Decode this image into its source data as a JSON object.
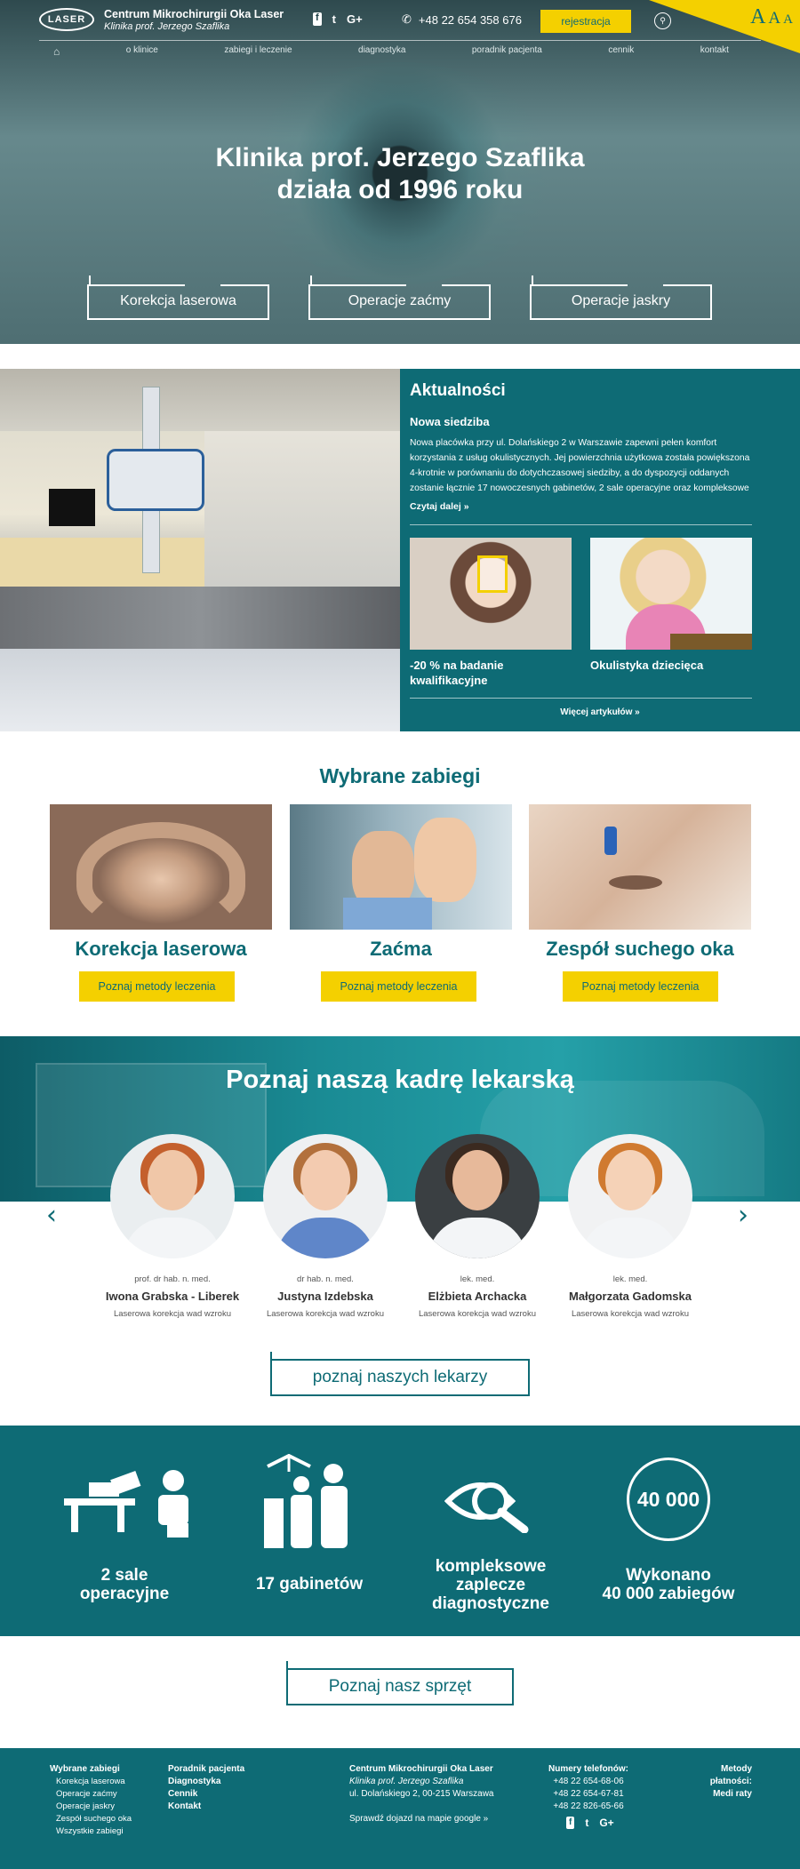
{
  "header": {
    "logo_text": "LASER",
    "brand_title": "Centrum Mikrochirurgii Oka Laser",
    "brand_subtitle": "Klinika prof. Jerzego Szaflika",
    "social": [
      "f",
      "t",
      "G+"
    ],
    "phone": "+48 22 654 358 676",
    "register_label": "rejestracja",
    "font_sizes": [
      "A",
      "A",
      "A"
    ],
    "nav": [
      "o klinice",
      "zabiegi i leczenie",
      "diagnostyka",
      "poradnik pacjenta",
      "cennik",
      "kontakt"
    ]
  },
  "hero": {
    "title_line1": "Klinika prof. Jerzego Szaflika",
    "title_line2": "działa od 1996 roku",
    "buttons": [
      "Korekcja laserowa",
      "Operacje zaćmy",
      "Operacje jaskry"
    ]
  },
  "news": {
    "heading": "Aktualności",
    "article_title": "Nowa siedziba",
    "article_text": "Nowa placówka przy ul. Dolańskiego 2 w Warszawie zapewni pełen komfort korzystania z usług okulistycznych. Jej powierzchnia użytkowa została powiększona 4-krotnie w porównaniu do dotychczasowej siedziby, a do dyspozycji oddanych zostanie łącznie 17 nowoczesnych gabinetów, 2 sale operacyjne oraz kompleksowe",
    "read_more": "Czytaj dalej »",
    "cards": [
      "-20 % na badanie kwalifikacyjne",
      "Okulistyka dziecięca"
    ],
    "more_articles": "Więcej artykułów »"
  },
  "treatments": {
    "heading": "Wybrane zabiegi",
    "items": [
      {
        "title": "Korekcja laserowa",
        "button": "Poznaj metody leczenia"
      },
      {
        "title": "Zaćma",
        "button": "Poznaj metody leczenia"
      },
      {
        "title": "Zespół suchego oka",
        "button": "Poznaj metody leczenia"
      }
    ]
  },
  "doctors": {
    "heading": "Poznaj naszą kadrę lekarską",
    "prev": "‹",
    "next": "›",
    "items": [
      {
        "title": "prof. dr hab. n. med.",
        "name": "Iwona Grabska - Liberek",
        "specialty": "Laserowa korekcja wad wzroku"
      },
      {
        "title": "dr hab. n. med.",
        "name": "Justyna Izdebska",
        "specialty": "Laserowa korekcja wad wzroku"
      },
      {
        "title": "lek. med.",
        "name": "Elżbieta Archacka",
        "specialty": "Laserowa korekcja wad wzroku"
      },
      {
        "title": "lek. med.",
        "name": "Małgorzata Gadomska",
        "specialty": "Laserowa korekcja wad wzroku"
      }
    ],
    "button": "poznaj naszych lekarzy"
  },
  "stats": {
    "items": [
      "2 sale operacyjne",
      "17 gabinetów",
      "kompleksowe zaplecze diagnostyczne",
      "Wykonano 40 000 zabiegów"
    ],
    "lines": [
      [
        "2 sale",
        "operacyjne"
      ],
      [
        "17 gabinetów"
      ],
      [
        "kompleksowe",
        "zaplecze",
        "diagnostyczne"
      ],
      [
        "Wykonano",
        "40 000 zabiegów"
      ]
    ],
    "circle": "40 000"
  },
  "equipment_button": "Poznaj nasz sprzęt",
  "footer": {
    "col1_title": "Wybrane zabiegi",
    "col1_items": [
      "Korekcja laserowa",
      "Operacje zaćmy",
      "Operacje jaskry",
      "Zespół suchego oka",
      "Wszystkie zabiegi"
    ],
    "col2_items": [
      "Poradnik pacjenta",
      "Diagnostyka",
      "Cennik",
      "Kontakt"
    ],
    "address_title": "Centrum Mikrochirurgii Oka Laser",
    "address_sub": "Klinika prof. Jerzego Szaflika",
    "address_street": "ul. Dolańskiego 2, 00-215 Warszawa",
    "map_link": "Sprawdź dojazd na mapie google »",
    "phones_title": "Numery telefonów:",
    "phones": [
      "+48 22 654-68-06",
      "+48 22 654-67-81",
      "+48 22 826-65-66"
    ],
    "social": [
      "f",
      "t",
      "G+"
    ],
    "payment_title": "Metody płatności:",
    "payment_item": "Medi raty"
  }
}
